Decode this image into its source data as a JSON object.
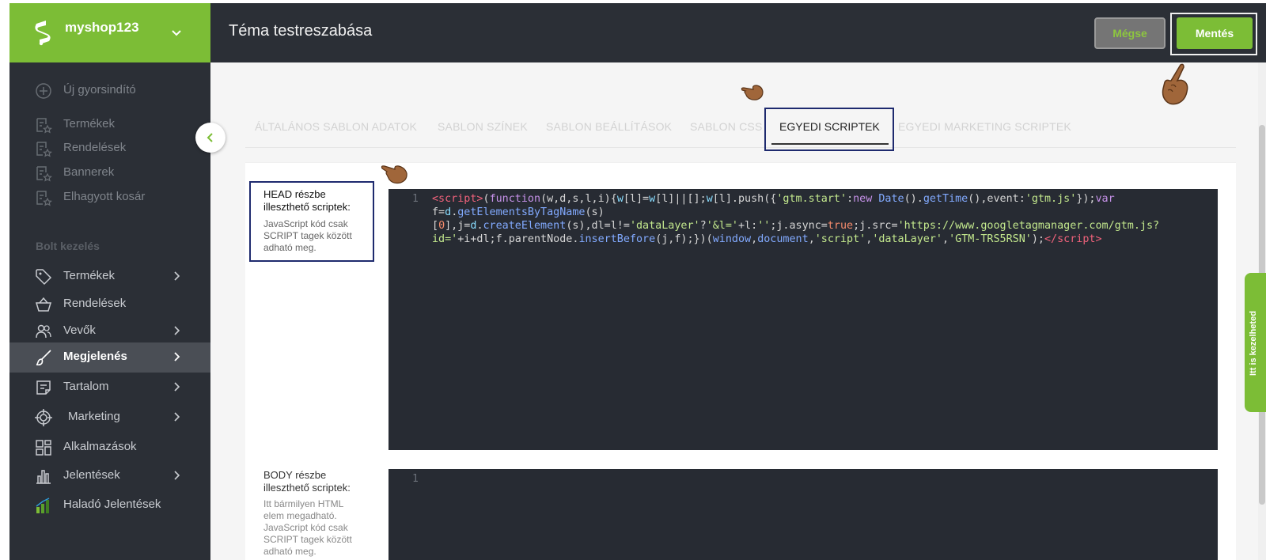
{
  "brand": {
    "name": "myshop123",
    "color": "#7cbd36"
  },
  "header": {
    "title": "Téma testreszabása",
    "cancel_label": "Mégse",
    "save_label": "Mentés"
  },
  "sidebar": {
    "top_items": [
      {
        "label": "Új gyorsindító",
        "icon": "plus-circle-icon"
      },
      {
        "label": "Termékek",
        "icon": "starred-list-icon"
      },
      {
        "label": "Rendelések",
        "icon": "starred-list-icon"
      },
      {
        "label": "Bannerek",
        "icon": "starred-list-icon"
      },
      {
        "label": "Elhagyott kosár",
        "icon": "starred-list-icon"
      }
    ],
    "section_title": "Bolt kezelés",
    "items": [
      {
        "label": "Termékek",
        "icon": "tag-icon",
        "has_children": true
      },
      {
        "label": "Rendelések",
        "icon": "basket-icon",
        "has_children": false
      },
      {
        "label": "Vevők",
        "icon": "users-icon",
        "has_children": true
      },
      {
        "label": "Megjelenés",
        "icon": "brush-icon",
        "has_children": true,
        "active": true
      },
      {
        "label": "Tartalom",
        "icon": "document-icon",
        "has_children": true
      },
      {
        "label": "Marketing",
        "icon": "target-icon",
        "has_children": true
      },
      {
        "label": "Alkalmazások",
        "icon": "apps-grid-icon",
        "has_children": false
      },
      {
        "label": "Jelentések",
        "icon": "bar-chart-icon",
        "has_children": true
      },
      {
        "label": "Haladó Jelentések",
        "icon": "advanced-chart-icon",
        "has_children": false
      }
    ]
  },
  "tabs": [
    {
      "label": "ÁLTALÁNOS SABLON ADATOK"
    },
    {
      "label": "SABLON SZÍNEK"
    },
    {
      "label": "SABLON BEÁLLÍTÁSOK"
    },
    {
      "label": "SABLON CSS"
    },
    {
      "label": "EGYEDI SCRIPTEK",
      "active": true
    },
    {
      "label": "EGYEDI MARKETING SCRIPTEK"
    }
  ],
  "head_section": {
    "title": "HEAD részbe illeszthető scriptek:",
    "help": "JavaScript kód csak SCRIPT tagek között adható meg.",
    "line_number": "1"
  },
  "body_section": {
    "title": "BODY részbe illeszthető scriptek:",
    "help": "Itt bármilyen HTML elem megadható. JavaScript kód csak SCRIPT tagek között adható meg.",
    "line_number": "1"
  },
  "help_tab": {
    "label": "Itt is kezelheted"
  }
}
